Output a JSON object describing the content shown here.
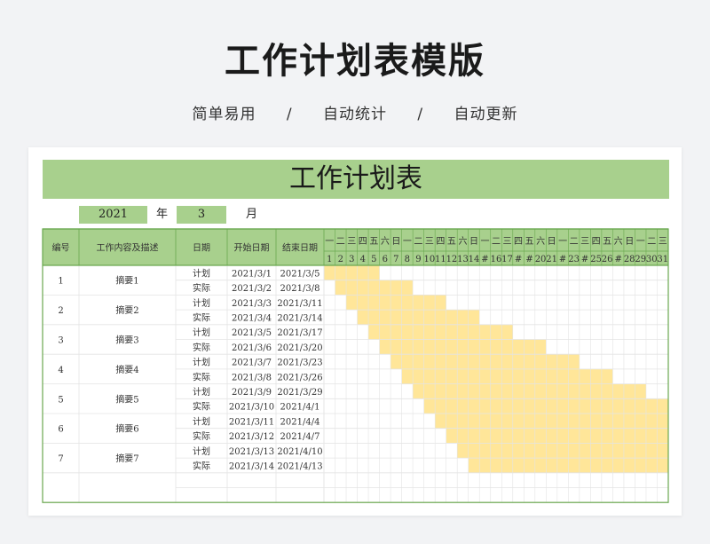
{
  "header": {
    "title": "工作计划表模版",
    "tags": [
      "简单易用",
      "自动统计",
      "自动更新"
    ],
    "separator": "/"
  },
  "sheet": {
    "title": "工作计划表",
    "year": "2021",
    "year_label": "年",
    "month": "3",
    "month_label": "月",
    "columns": {
      "id": "编号",
      "desc": "工作内容及描述",
      "date": "日期",
      "start": "开始日期",
      "end": "结束日期"
    },
    "weekdays": [
      "一",
      "二",
      "三",
      "四",
      "五",
      "六",
      "日",
      "一",
      "二",
      "三",
      "四",
      "五",
      "六",
      "日",
      "一",
      "二",
      "三",
      "四",
      "五",
      "六",
      "日",
      "一",
      "二",
      "三",
      "四",
      "五",
      "六",
      "日",
      "一",
      "二",
      "三"
    ],
    "days": [
      "1",
      "2",
      "3",
      "4",
      "5",
      "6",
      "7",
      "8",
      "9",
      "10",
      "11",
      "12",
      "13",
      "14",
      "#",
      "16",
      "17",
      "#",
      "#",
      "20",
      "21",
      "#",
      "23",
      "#",
      "25",
      "26",
      "#",
      "28",
      "29",
      "30",
      "31"
    ],
    "tasks": [
      {
        "id": "1",
        "desc": "摘要1",
        "plan_label": "计划",
        "actual_label": "实际",
        "plan_start": "2021/3/1",
        "plan_end": "2021/3/5",
        "actual_start": "2021/3/2",
        "actual_end": "2021/3/8"
      },
      {
        "id": "2",
        "desc": "摘要2",
        "plan_label": "计划",
        "actual_label": "实际",
        "plan_start": "2021/3/3",
        "plan_end": "2021/3/11",
        "actual_start": "2021/3/4",
        "actual_end": "2021/3/14"
      },
      {
        "id": "3",
        "desc": "摘要3",
        "plan_label": "计划",
        "actual_label": "实际",
        "plan_start": "2021/3/5",
        "plan_end": "2021/3/17",
        "actual_start": "2021/3/6",
        "actual_end": "2021/3/20"
      },
      {
        "id": "4",
        "desc": "摘要4",
        "plan_label": "计划",
        "actual_label": "实际",
        "plan_start": "2021/3/7",
        "plan_end": "2021/3/23",
        "actual_start": "2021/3/8",
        "actual_end": "2021/3/26"
      },
      {
        "id": "5",
        "desc": "摘要5",
        "plan_label": "计划",
        "actual_label": "实际",
        "plan_start": "2021/3/9",
        "plan_end": "2021/3/29",
        "actual_start": "2021/3/10",
        "actual_end": "2021/4/1"
      },
      {
        "id": "6",
        "desc": "摘要6",
        "plan_label": "计划",
        "actual_label": "实际",
        "plan_start": "2021/3/11",
        "plan_end": "2021/4/4",
        "actual_start": "2021/3/12",
        "actual_end": "2021/4/7"
      },
      {
        "id": "7",
        "desc": "摘要7",
        "plan_label": "计划",
        "actual_label": "实际",
        "plan_start": "2021/3/13",
        "plan_end": "2021/4/10",
        "actual_start": "2021/3/14",
        "actual_end": "2021/4/13"
      }
    ],
    "colors": {
      "header_green": "#a8d08d",
      "border_green": "#6aa84f",
      "gantt_fill": "#ffe699",
      "grid": "#e4e4e4"
    }
  }
}
